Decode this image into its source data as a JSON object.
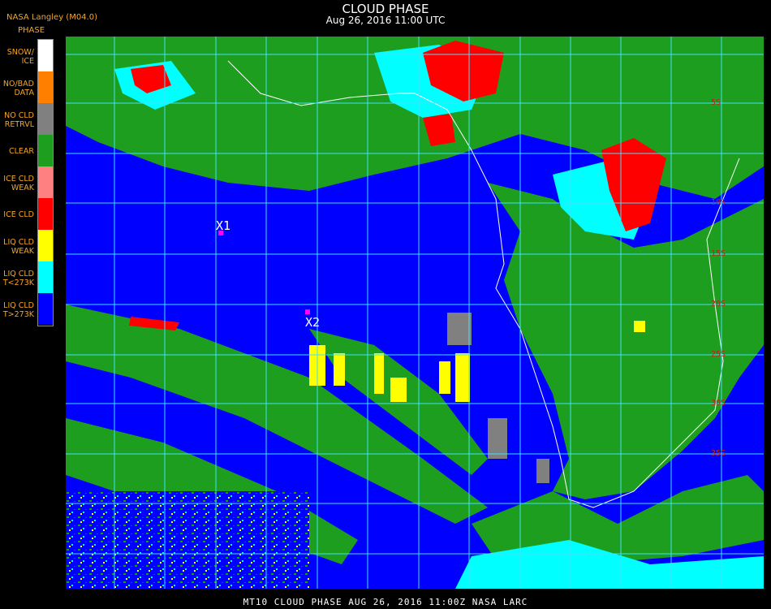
{
  "header": {
    "title": "CLOUD PHASE",
    "date": "Aug 26, 2016 11:00 UTC",
    "source": "NASA Langley (M04.0)"
  },
  "legend": {
    "title": "PHASE",
    "items": [
      {
        "label": "SNOW/\nICE",
        "color": "#ffffff"
      },
      {
        "label": "NO/BAD\nDATA",
        "color": "#ff8000"
      },
      {
        "label": "NO CLD\nRETRVL",
        "color": "#808080"
      },
      {
        "label": "CLEAR",
        "color": "#1e9e1e"
      },
      {
        "label": "ICE CLD\nWEAK",
        "color": "#ff8080"
      },
      {
        "label": "ICE CLD",
        "color": "#ff0000"
      },
      {
        "label": "LIQ CLD\nWEAK",
        "color": "#ffff00"
      },
      {
        "label": "LIQ CLD\nT<273K",
        "color": "#00ffff"
      },
      {
        "label": "LIQ CLD\nT>273K",
        "color": "#0000ff"
      }
    ]
  },
  "markers": [
    {
      "label": "X1",
      "color": "#ff00ff"
    },
    {
      "label": "X2",
      "color": "#ff00ff"
    }
  ],
  "grid": {
    "color": "#40e0ff",
    "lat_labels": [
      "5S",
      "10S",
      "15S",
      "20S",
      "25S",
      "30S",
      "35S"
    ]
  },
  "footer": "MT10  CLOUD PHASE   AUG 26, 2016 11:00Z   NASA LARC"
}
